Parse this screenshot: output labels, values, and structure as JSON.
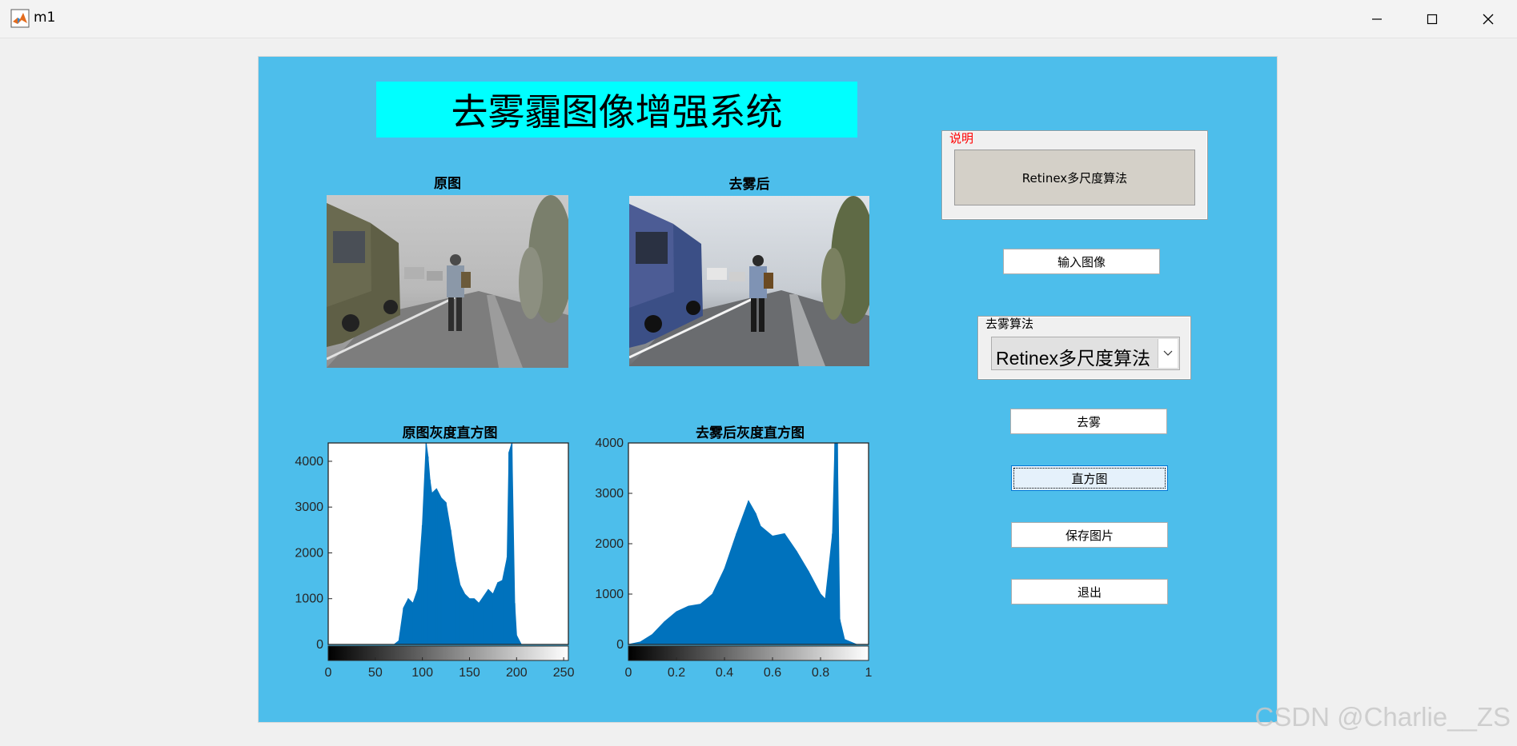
{
  "window": {
    "title": "m1",
    "controls": [
      "minimize-icon",
      "maximize-icon",
      "close-icon"
    ]
  },
  "main_title": "去雾霾图像增强系统",
  "axes": {
    "original_title": "原图",
    "dehazed_title": "去雾后",
    "hist_original_title": "原图灰度直方图",
    "hist_dehazed_title": "去雾后灰度直方图"
  },
  "description_panel": {
    "legend": "说明",
    "text": "Retinex多尺度算法"
  },
  "buttons": {
    "input_image": "输入图像",
    "dehaze": "去雾",
    "histogram": "直方图",
    "save_image": "保存图片",
    "exit": "退出"
  },
  "algorithm_panel": {
    "legend": "去雾算法",
    "selected": "Retinex多尺度算法"
  },
  "colors": {
    "figure_bg": "#4dbeeb",
    "title_bg": "#00ffff",
    "hist_bar": "#0072bd",
    "legend_red": "#ff0000"
  },
  "watermark": "CSDN @Charlie__ZS",
  "chart_data": [
    {
      "type": "bar",
      "title": "原图灰度直方图",
      "x": [
        0,
        10,
        20,
        30,
        40,
        50,
        60,
        70,
        75,
        80,
        85,
        90,
        95,
        100,
        104,
        106,
        108,
        110,
        115,
        120,
        125,
        130,
        135,
        140,
        145,
        150,
        155,
        160,
        165,
        170,
        175,
        180,
        185,
        190,
        192,
        195,
        198,
        200,
        205,
        210,
        220,
        230,
        240,
        250
      ],
      "values": [
        0,
        0,
        0,
        0,
        0,
        0,
        0,
        0,
        80,
        800,
        1000,
        900,
        1200,
        2600,
        4400,
        4100,
        3600,
        3300,
        3400,
        3200,
        3100,
        2500,
        1800,
        1300,
        1100,
        1000,
        1000,
        900,
        1050,
        1200,
        1100,
        1350,
        1400,
        1900,
        4200,
        4400,
        900,
        200,
        0,
        0,
        0,
        0,
        0,
        0
      ],
      "xticks": [
        "0",
        "50",
        "100",
        "150",
        "200",
        "250"
      ],
      "yticks": [
        "0",
        "1000",
        "2000",
        "3000",
        "4000"
      ],
      "xlim": [
        0,
        255
      ],
      "ylim": [
        0,
        4400
      ],
      "colorbar": "gray"
    },
    {
      "type": "bar",
      "title": "去雾后灰度直方图",
      "x": [
        0,
        0.05,
        0.1,
        0.15,
        0.2,
        0.25,
        0.3,
        0.35,
        0.4,
        0.45,
        0.5,
        0.53,
        0.55,
        0.6,
        0.65,
        0.7,
        0.75,
        0.8,
        0.82,
        0.85,
        0.86,
        0.87,
        0.88,
        0.9,
        0.95,
        1
      ],
      "values": [
        0,
        50,
        200,
        450,
        650,
        760,
        800,
        1000,
        1500,
        2200,
        2850,
        2600,
        2350,
        2150,
        2200,
        1850,
        1450,
        1000,
        900,
        2200,
        4000,
        4000,
        500,
        100,
        0,
        0
      ],
      "xticks": [
        "0",
        "0.2",
        "0.4",
        "0.6",
        "0.8",
        "1"
      ],
      "yticks": [
        "0",
        "1000",
        "2000",
        "3000",
        "4000"
      ],
      "xlim": [
        0,
        1
      ],
      "ylim": [
        0,
        4000
      ],
      "colorbar": "gray"
    }
  ]
}
